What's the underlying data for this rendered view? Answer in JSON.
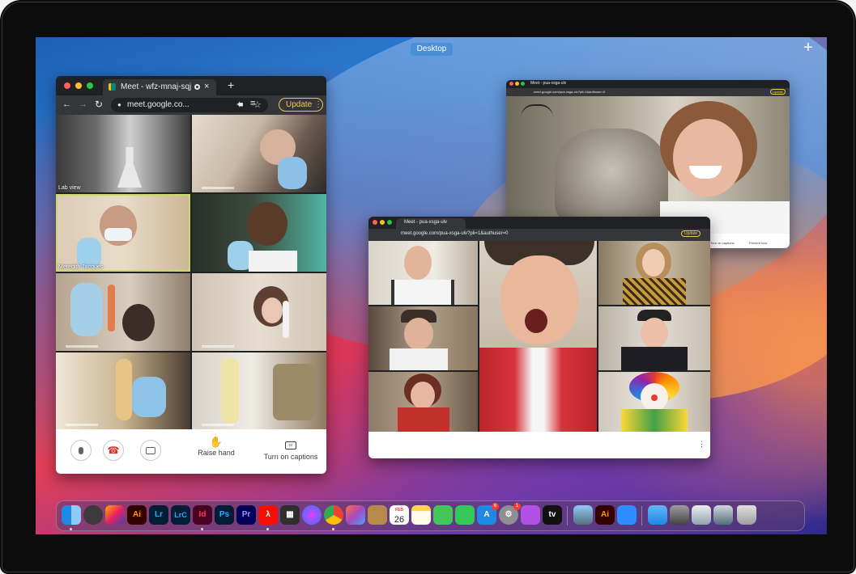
{
  "desktop": {
    "space_label": "Desktop",
    "add_space": "+"
  },
  "window_main": {
    "tab_title": "Meet - wfz-mnaj-sqj",
    "tab_close": "×",
    "new_tab": "+",
    "url": "meet.google.co...",
    "update_label": "Update",
    "tiles": [
      {
        "name": "Lab view"
      },
      {
        "name": ""
      },
      {
        "name": "Meredith Jacques"
      },
      {
        "name": ""
      },
      {
        "name": ""
      },
      {
        "name": ""
      },
      {
        "name": ""
      },
      {
        "name": ""
      }
    ],
    "controls": {
      "raise_hand": "Raise hand",
      "captions": "Turn on captions"
    }
  },
  "window_top_right": {
    "tab_title": "Meet - pua-xsga-ulv",
    "url": "meet.google.com/pua-xsga-ulv?pli=1&authuser=0",
    "update_label": "Update",
    "captions": "Turn on captions",
    "present": "Present now"
  },
  "window_middle": {
    "tab_title": "Meet - pua-xsga-ulv",
    "url": "meet.google.com/pua-xsga-ulv?pli=1&authuser=0",
    "update_label": "Update",
    "more": "⋮"
  },
  "dock": {
    "calendar_month": "FEB",
    "calendar_day": "26",
    "apps": [
      "Finder",
      "QuickTime",
      "Final Cut",
      "Illustrator",
      "Lightroom",
      "Lightroom Classic",
      "InDesign",
      "Photoshop",
      "Premiere",
      "Acrobat",
      "Calculator",
      "Siri",
      "Chrome",
      "Launchpad",
      "Keka",
      "Calendar",
      "Notes",
      "Messages",
      "FaceTime",
      "App Store",
      "System Preferences",
      "Podcasts",
      "Apple TV",
      "Preview",
      "Illustrator",
      "Zoom",
      "Screenshot 1",
      "Screenshot 2",
      "Screenshot 3",
      "Screenshot 4",
      "Trash"
    ],
    "labels": {
      "ai": "Ai",
      "lr": "Lr",
      "lrc": "LrC",
      "id": "Id",
      "ps": "Ps",
      "pr": "Pr",
      "tv": "tv",
      "badge_appstore": "6",
      "badge_settings": "1"
    }
  },
  "colors": {
    "bezel": "#0c0c0c",
    "chrome_dark": "#202124",
    "update_yellow": "#f2c94c",
    "meet_red": "#d93025"
  }
}
